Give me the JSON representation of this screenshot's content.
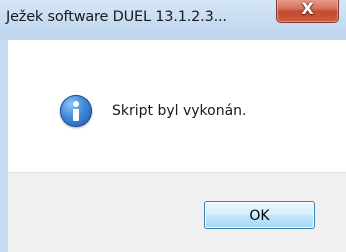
{
  "window": {
    "title": "Ježek software DUEL 13.1.2.3...",
    "close_glyph": "X"
  },
  "dialog": {
    "icon": "info-icon",
    "message": "Skript byl vykonán.",
    "ok_label": "OK"
  },
  "colors": {
    "titlebar": "#c6dbf1",
    "close_button": "#c44a32",
    "info_icon": "#3f87d8",
    "footer": "#f0f0f0",
    "ok_button_border": "#3c7fb1"
  }
}
